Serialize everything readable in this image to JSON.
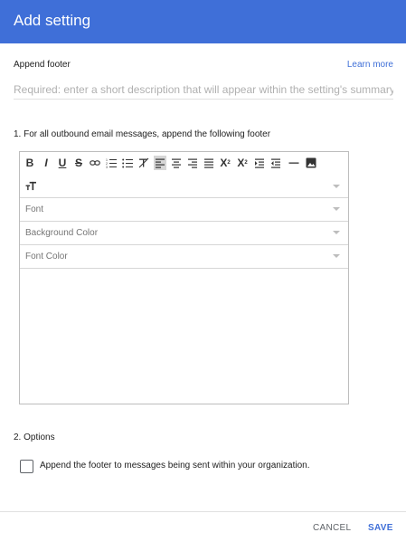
{
  "dialog": {
    "title": "Add setting"
  },
  "setting": {
    "name_label": "Append footer",
    "learn_more": "Learn more",
    "description_placeholder": "Required: enter a short description that will appear within the setting's summary."
  },
  "section1": {
    "heading": "1. For all outbound email messages, append the following footer"
  },
  "editor": {
    "toolbar_icons": [
      "bold-icon",
      "italic-icon",
      "underline-icon",
      "strikethrough-icon",
      "link-icon",
      "numbered-list-icon",
      "bulleted-list-icon",
      "clear-formatting-icon",
      "align-left-icon",
      "align-center-icon",
      "align-right-icon",
      "align-justify-icon",
      "subscript-icon",
      "superscript-icon",
      "indent-icon",
      "outdent-icon",
      "horizontal-rule-icon",
      "image-icon"
    ],
    "font_size_icon": "font-size-icon",
    "font_placeholder": "Font",
    "background_color_placeholder": "Background Color",
    "font_color_placeholder": "Font Color"
  },
  "section2": {
    "heading": "2. Options",
    "checkbox_label": "Append the footer to messages being sent within your organization.",
    "checkbox_checked": false
  },
  "actions": {
    "cancel_label": "CANCEL",
    "save_label": "SAVE"
  },
  "colors": {
    "accent": "#3f6fd8",
    "header_bg": "#3f6fd8"
  }
}
